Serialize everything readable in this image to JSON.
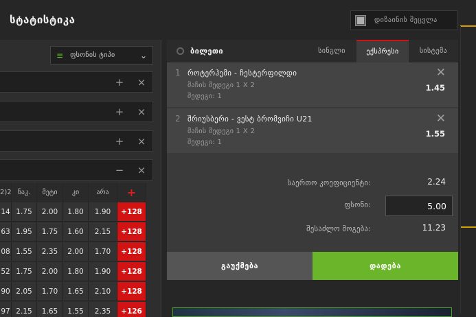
{
  "header": {
    "title": "სტატისტიკა",
    "design_toggle_label": "დიზაინის შეცვლა"
  },
  "left": {
    "bettype_select": "ფსონის ტიპი",
    "group_rows": [
      {
        "plus": "+",
        "close": "×"
      },
      {
        "plus": "+",
        "close": "×"
      },
      {
        "plus": "+",
        "close": "×"
      },
      {
        "plus": "−",
        "close": "×"
      }
    ],
    "table_headers": [
      "2)2",
      "ნაკ.",
      "მეტი",
      "კი",
      "არა",
      "+"
    ],
    "rows": [
      [
        "14",
        "1.75",
        "2.00",
        "1.80",
        "1.90",
        "+128"
      ],
      [
        "63",
        "1.95",
        "1.75",
        "1.60",
        "2.15",
        "+128"
      ],
      [
        "08",
        "1.55",
        "2.35",
        "2.00",
        "1.70",
        "+128"
      ],
      [
        "52",
        "1.75",
        "2.00",
        "1.80",
        "1.90",
        "+128"
      ],
      [
        "90",
        "2.05",
        "1.70",
        "1.65",
        "2.10",
        "+128"
      ],
      [
        "97",
        "2.15",
        "1.65",
        "1.55",
        "2.35",
        "+126"
      ]
    ]
  },
  "slip": {
    "title": "ბილეთი",
    "tabs": [
      "სინგლი",
      "ექსპრესი",
      "სისტემა"
    ],
    "selections": [
      {
        "num": "1",
        "match": "როტერჰემი - ჩესტერფილდი",
        "market": "მაჩის შედეგი 1 X 2",
        "result": "შედეგი: 1",
        "odd": "1.45"
      },
      {
        "num": "2",
        "match": "შრიუსბერი - ვესტ ბრომვიჩი U21",
        "market": "მაჩის შედეგი 1 X 2",
        "result": "შედეგი: 1",
        "odd": "1.55"
      }
    ],
    "total_odds_label": "საერთო კოეფიციენტი:",
    "total_odds": "2.24",
    "stake_label": "ფსონი:",
    "stake": "5.00",
    "possible_win_label": "შესაძლო მოგება:",
    "possible_win": "11.23",
    "clear_button": "გაუქმება",
    "place_button": "დადება"
  }
}
